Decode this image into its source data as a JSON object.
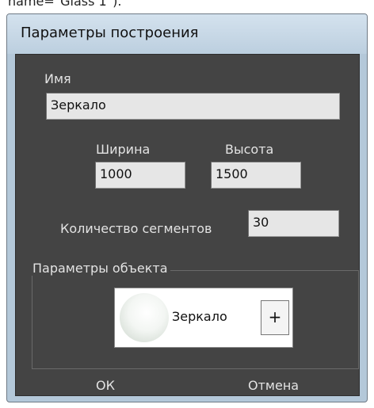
{
  "top_text": "name=\"Glass 1\").",
  "dialog": {
    "title": "Параметры построения",
    "name_label": "Имя",
    "name_value": "Зеркало",
    "width_label": "Ширина",
    "width_value": "1000",
    "height_label": "Высота",
    "height_value": "1500",
    "segments_label": "Количество сегментов",
    "segments_value": "30",
    "object_group_title": "Параметры объекта",
    "material_name": "Зеркало",
    "add_label": "+",
    "ok_label": "ОК",
    "cancel_label": "Отмена"
  }
}
